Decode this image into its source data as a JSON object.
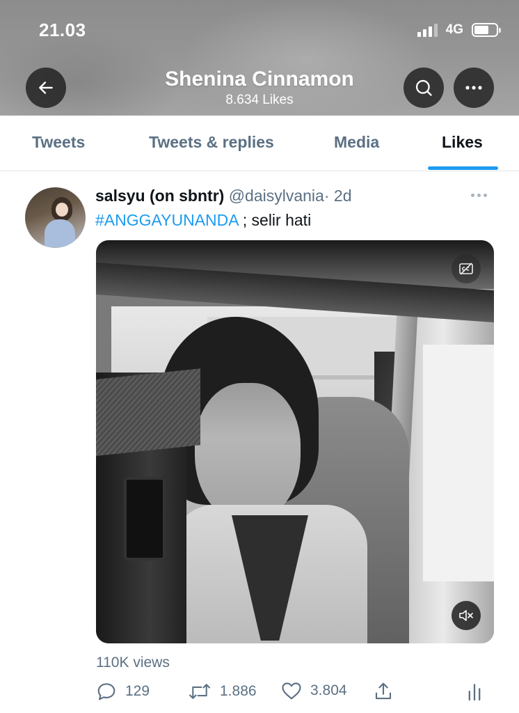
{
  "status_bar": {
    "time": "21.03",
    "network": "4G"
  },
  "header": {
    "profile_name": "Shenina Cinnamon",
    "likes_count": "8.634 Likes"
  },
  "tabs": [
    {
      "label": "Tweets",
      "active": false
    },
    {
      "label": "Tweets & replies",
      "active": false
    },
    {
      "label": "Media",
      "active": false
    },
    {
      "label": "Likes",
      "active": true
    }
  ],
  "tweet": {
    "display_name": "salsyu (on sbntr)",
    "handle": "@daisylvania",
    "separator": "·",
    "time": "2d",
    "hashtag": "#ANGGAYUNANDA",
    "text_rest": " ; selir hati",
    "views": "110K views",
    "stats": {
      "replies": "129",
      "retweets": "1.886",
      "likes": "3.804"
    }
  },
  "colors": {
    "accent": "#1d9bf0",
    "secondary_text": "#5b7083",
    "primary_text": "#0f1419"
  },
  "icons": [
    "back-arrow-icon",
    "search-icon",
    "more-icon",
    "closed-caption-icon",
    "mute-icon",
    "reply-icon",
    "retweet-icon",
    "like-icon",
    "share-icon",
    "analytics-icon"
  ]
}
